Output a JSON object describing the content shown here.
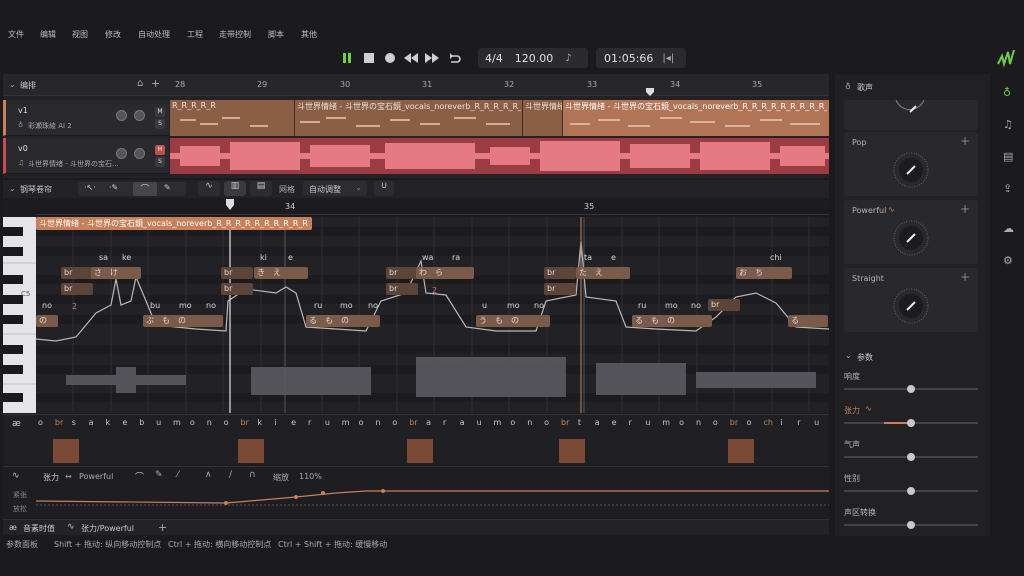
{
  "menu": [
    "文件",
    "编辑",
    "视图",
    "修改",
    "自动处理",
    "工程",
    "走带控制",
    "脚本",
    "其他"
  ],
  "transport": {
    "time_signature": "4/4",
    "tempo": "120.00",
    "time": "01:05:66"
  },
  "arrangement": {
    "title": "编排",
    "ruler": [
      "28",
      "29",
      "30",
      "31",
      "32",
      "33",
      "34",
      "35"
    ],
    "tracks": [
      {
        "name": "v1",
        "singer": "彩瀬珠綾 AI 2",
        "clip_labels": [
          "R_R_R_R_R",
          "斗世界情绪 - 斗世界の宝石鏡_vocals_noreverb_R_R_R_R_R_",
          "斗世界情绪",
          "斗世界情绪 - 斗世界の宝石鏡_vocals_noreverb_R_R_R_R_R_R_R_R_R_"
        ]
      },
      {
        "name": "v0",
        "singer": "斗世界情绪 - 斗世界の宝石..."
      }
    ],
    "accent": "#c8805a",
    "audio_color": "#c44c55"
  },
  "pianoroll": {
    "title": "钢琴卷帘",
    "snap_label": "网格",
    "snap_value": "自动调整",
    "ruler": [
      "34",
      "35"
    ],
    "clip_name": "斗世界情绪 - 斗世界の宝石鏡_vocals_noreverb_R_R_R_R_R_R_R_R_R_R",
    "octave_label": "C5",
    "lyrics": [
      "sa",
      "ke",
      "ki",
      "e",
      "wa",
      "ra",
      "ta",
      "e",
      "chi",
      "bu",
      "mo",
      "no",
      "ru",
      "mo",
      "no",
      "u",
      "mo",
      "no",
      "ru",
      "mo",
      "no",
      "no"
    ],
    "note_badges": [
      "2",
      "2"
    ]
  },
  "phonemes": [
    "o",
    "br",
    "s",
    "a",
    "k",
    "e",
    "b",
    "u",
    "m",
    "o",
    "n",
    "o",
    "br",
    "k",
    "i",
    "e",
    "r",
    "u",
    "m",
    "o",
    "n",
    "o",
    "br",
    "a",
    "r",
    "a",
    "u",
    "m",
    "o",
    "n",
    "o",
    "br",
    "t",
    "a",
    "e",
    "r",
    "u",
    "m",
    "o",
    "n",
    "o",
    "br",
    "o",
    "ch",
    "i",
    "r",
    "u"
  ],
  "param_lane": {
    "param_name": "张力",
    "arrow": "↔",
    "param_value": "Powerful",
    "zoom_label": "缩放",
    "zoom_value": "110%",
    "lane_top": "紧张",
    "lane_bottom": "放松"
  },
  "bottom_tabs": [
    "音素时值",
    "张力/Powerful"
  ],
  "statusbar": [
    "参数面板",
    "Shift + 拖动: 纵向移动控制点",
    "Ctrl + 拖动: 横向移动控制点",
    "Ctrl + Shift + 拖动: 缓慢移动"
  ],
  "right_panel": {
    "voice_title": "歌声",
    "cards": [
      "Pop",
      "Powerful",
      "Straight"
    ],
    "params_title": "参数",
    "params": [
      "响度",
      "张力",
      "气声",
      "性别",
      "声区转换"
    ],
    "param_levels": [
      0.5,
      0.5,
      0.5,
      0.5,
      0.5
    ]
  }
}
